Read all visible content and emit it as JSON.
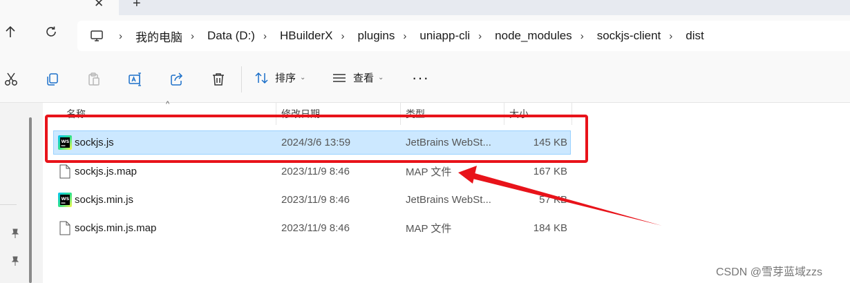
{
  "window": {
    "tab_close_glyph": "✕",
    "tab_new_glyph": "+"
  },
  "nav": {
    "up_icon": "up-arrow-icon",
    "refresh_icon": "refresh-icon",
    "breadcrumbs": [
      "我的电脑",
      "Data (D:)",
      "HBuilderX",
      "plugins",
      "uniapp-cli",
      "node_modules",
      "sockjs-client",
      "dist"
    ],
    "separator": "›"
  },
  "toolbar": {
    "icons": [
      "cut-icon",
      "copy-icon",
      "paste-icon",
      "rename-icon",
      "share-icon",
      "delete-icon"
    ],
    "sort_label": "排序",
    "view_label": "查看",
    "more_label": "···",
    "chevron": "⌄"
  },
  "columns": {
    "name": "名称",
    "date": "修改日期",
    "type": "类型",
    "size": "大小",
    "sort_caret": "^"
  },
  "files": [
    {
      "name": "sockjs.js",
      "date": "2024/3/6 13:59",
      "type": "JetBrains WebSt...",
      "size": "145 KB",
      "icon": "webstorm-file-icon",
      "selected": true
    },
    {
      "name": "sockjs.js.map",
      "date": "2023/11/9 8:46",
      "type": "MAP 文件",
      "size": "167 KB",
      "icon": "generic-file-icon",
      "selected": false
    },
    {
      "name": "sockjs.min.js",
      "date": "2023/11/9 8:46",
      "type": "JetBrains WebSt...",
      "size": "57 KB",
      "icon": "webstorm-file-icon",
      "selected": false
    },
    {
      "name": "sockjs.min.js.map",
      "date": "2023/11/9 8:46",
      "type": "MAP 文件",
      "size": "184 KB",
      "icon": "generic-file-icon",
      "selected": false
    }
  ],
  "annotation": {
    "color": "#e8131a"
  },
  "watermark": "CSDN @雪芽蓝域zzs"
}
